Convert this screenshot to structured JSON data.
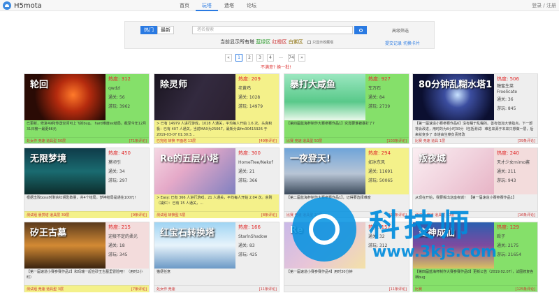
{
  "app": {
    "name": "H5mota"
  },
  "nav": [
    "首页",
    "玩塔",
    "造塔",
    "论坛"
  ],
  "login": "登录 / 注册",
  "search": {
    "sort_tabs": [
      "热门",
      "最新"
    ],
    "placeholder": "塔名搜索",
    "advanced": "高级筛选",
    "filter_prefix": "当前显示所有塔",
    "filter_green": "蓝绿区",
    "filter_red": "红橙区",
    "filter_white": "白紫区",
    "only_favorites": "只显示收藏塔",
    "submit_record": "提交记录",
    "switch_card": "切换卡片"
  },
  "pagination": {
    "prev": "«",
    "pages": [
      "1",
      "2",
      "3",
      "4"
    ],
    "dots": "…",
    "last": "74",
    "next": "»"
  },
  "unsatisfied": "不满意? 换一批!",
  "cards": [
    {
      "title": "轮回",
      "heat": "热度: 312",
      "author": "qwdzl",
      "pass": "通关: 56",
      "plays": "游玩: 3962",
      "desc": "已更新，修复49和传送空间可上飞的bug。 hard难度ex结局。截至今年12月31日榜一最更66元",
      "tags": "处女作 竞速 道具型 50层",
      "comments": "[71条评论]"
    },
    {
      "title": "除灵师",
      "heat": "热度: 209",
      "author": "老黄鸡",
      "pass": "通关: 1028",
      "plays": "游玩: 14979",
      "desc": "> 已有 14979 人进行游戏，1028 人通关，平均每人开始 1.6 次。头真积极：已有 407 人通关，当前MAX为25067，最新分由fm30415926 于2019-03-07 01:30:3...",
      "tags": "已完结 转换 平面塔 13层",
      "comments": "[49条评论]"
    },
    {
      "title": "暴打大咸鱼",
      "heat": "热度: 927",
      "author": "车万石",
      "pass": "通关: 84",
      "plays": "游玩: 2739",
      "desc": "【第四届蓝海杯制作大赛参赛作品1】究竟要谁被暴打了?",
      "tags": "比赛 竞速 道具型 50层",
      "comments": "[103条评论]"
    },
    {
      "title": "80分钟乱糊水塔1",
      "heat": "热度: 506",
      "author": "糖蜜生菜",
      "author2": "Froelicate",
      "pass": "通关: 36",
      "plays": "游玩: 845",
      "desc": "【第一届速造小赛参赛作品6】没有糊于乱糊的。善有但加大使指点。下一部将会改进，用时的为8小时30分（包括测试）难名来源于本来只想做一层，后来就变多了 本塔由生菜负责修改",
      "tags": "比赛 竞速 道具 1层",
      "comments": "[39条评论]"
    },
    {
      "title": "无限梦境",
      "heat": "热度: 450",
      "author": "莫顷引",
      "pass": "通关: 34",
      "plays": "游玩: 297",
      "desc": "根据击败boss时剩余红钥匙数量，共4个结局，梦神结局是通往100元！",
      "tags": "测试组 悬赏塔 道具层 39层",
      "comments": "[9条评论]"
    },
    {
      "title": "Re的五层小塔",
      "heat": "热度: 300",
      "author": "HomeTree/Nekof",
      "pass": "通关: 21",
      "plays": "游玩: 366",
      "desc": "> Easy: 已有 366 人进行游戏，21 人通关，平均每人开始 2.04 次。余则（减红）：已有 15 人通关，...",
      "tags": "测试组 转换型 5层",
      "comments": "[8条评论]"
    },
    {
      "title": "一夜登天!",
      "heat": "热度: 294",
      "author": "如冰东风",
      "pass": "通关: 11691",
      "plays": "游玩: 50065",
      "desc": "【第二届蓝海杯制作大赛参赛作品1】，记得要选择难度",
      "tags": "比赛 竞速 道具型 20层",
      "comments": "[95条评论]"
    },
    {
      "title": "叛夜城",
      "heat": "热度: 240",
      "author": "天才少女mimo酱",
      "pass": "通关: 211",
      "plays": "游玩: 943",
      "desc": "从现在开始，我要叛出这座夜城！ 【第一届速造小赛参赛作品1】",
      "tags": "测试组 竞速 道具层 50层",
      "comments": "[16条评论]"
    },
    {
      "title": "矽王古墓",
      "heat": "热度: 215",
      "author": "迎接不定的柔光",
      "pass": "通关: 18",
      "plays": "游玩: 345",
      "desc": "【第一届速造小赛参赛作品2】和玛瑞一起在矽王古墓里冒险吧！（用时2小时）",
      "tags": "测试组 竞速 道具型 3层",
      "comments": "[7条评论]"
    },
    {
      "title": "红宝石转换塔",
      "heat": "热度: 166",
      "author": "StarlnShadow",
      "pass": "通关: 83",
      "plays": "游玩: 425",
      "desc": "猫便任意",
      "tags": "处女作 竞速",
      "comments": "[11条评论]"
    },
    {
      "title": "Re",
      "heat": "热度: 157",
      "author": "",
      "pass": "通关: 32",
      "plays": "游玩: 312",
      "desc": "【第一届速造小赛参赛作品4】用时30分钟",
      "tags": "",
      "comments": "[11条评论]"
    },
    {
      "title": "变神成仙",
      "heat": "热度: 129",
      "author": "殴子",
      "pass": "通关: 2175",
      "plays": "游玩: 21654",
      "desc": "【第四届蓝海杯制作大赛参赛作品8】更新公告（2019.02.07），试图修复各档bug",
      "tags": "比赛",
      "comments": "[125条评论]"
    }
  ],
  "watermark": {
    "text": "科技师",
    "url": "www.3kjs.com"
  },
  "colors": {
    "accent": "#2a7ae2",
    "heat": "#e02b2b",
    "card_green": "#85e06a",
    "card_yellow": "#f4f18a",
    "card_pink": "#f3dcdc",
    "watermark": "#0091e1"
  }
}
